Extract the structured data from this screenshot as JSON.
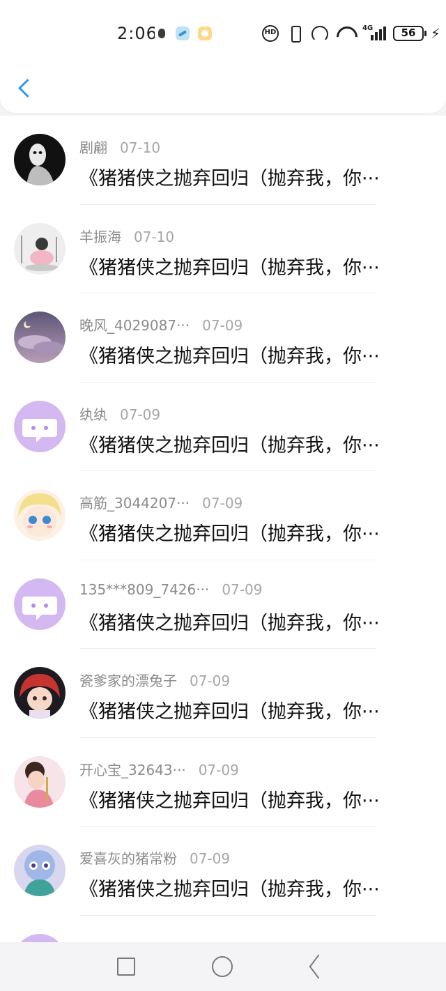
{
  "status_bar": {
    "time": "2:06",
    "signal_type": "4G",
    "battery": "56",
    "icons": [
      "record-icon",
      "browser-icon",
      "app-icon",
      "hd-icon",
      "vibrate-icon",
      "hotspot-icon",
      "wifi-icon",
      "signal-icon",
      "battery-icon",
      "charging-icon"
    ]
  },
  "header": {
    "back_icon": "chevron-left-icon",
    "accent": "#2f9ae8"
  },
  "comments": [
    {
      "name": "剧翩",
      "date": "07-10",
      "message": "《猪猪侠之抛弃回归（抛弃我，你···"
    },
    {
      "name": "羊振海",
      "date": "07-10",
      "message": "《猪猪侠之抛弃回归（抛弃我，你···"
    },
    {
      "name": "晚风_4029087···",
      "date": "07-09",
      "message": "《猪猪侠之抛弃回归（抛弃我，你···"
    },
    {
      "name": "纨纨",
      "date": "07-09",
      "message": "《猪猪侠之抛弃回归（抛弃我，你···"
    },
    {
      "name": "高筋_3044207···",
      "date": "07-09",
      "message": "《猪猪侠之抛弃回归（抛弃我，你···"
    },
    {
      "name": "135***809_7426···",
      "date": "07-09",
      "message": "《猪猪侠之抛弃回归（抛弃我，你···"
    },
    {
      "name": "瓷爹家的漂兔子",
      "date": "07-09",
      "message": "《猪猪侠之抛弃回归（抛弃我，你···"
    },
    {
      "name": "开心宝_32643···",
      "date": "07-09",
      "message": "《猪猪侠之抛弃回归（抛弃我，你···"
    },
    {
      "name": "爱喜灰的猪常粉",
      "date": "07-09",
      "message": "《猪猪侠之抛弃回归（抛弃我，你···"
    }
  ],
  "nav": {
    "icons": [
      "recents-square-icon",
      "home-circle-icon",
      "back-triangle-icon"
    ]
  }
}
